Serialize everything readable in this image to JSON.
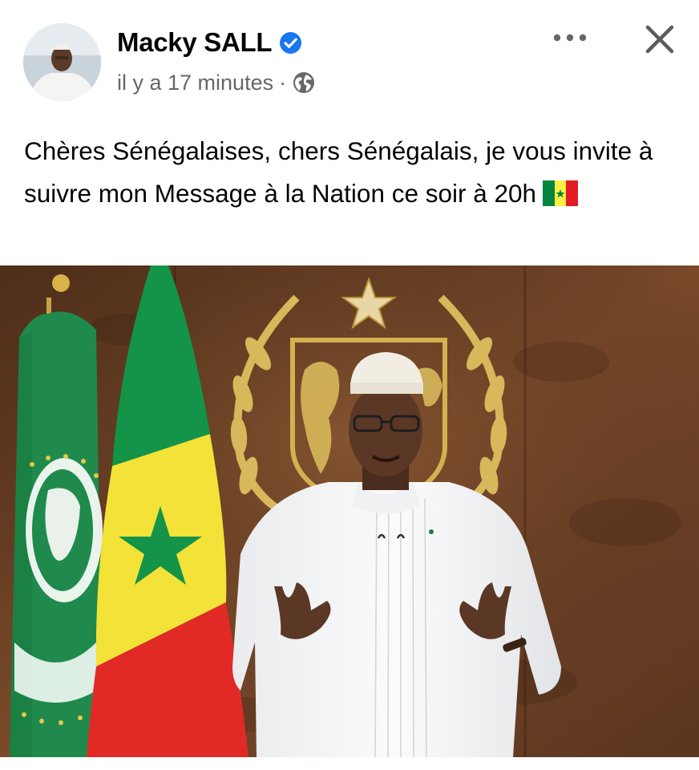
{
  "post": {
    "author": "Macky SALL",
    "verified_badge": "verified-badge-icon",
    "timestamp": "il y a 17 minutes",
    "separator": "·",
    "audience_icon": "globe-icon",
    "text": "Chères Sénégalaises, chers Sénégalais, je vous invite à suivre mon Message à la Nation ce soir à 20h",
    "emoji": "senegal-flag-emoji"
  },
  "actions": {
    "more_icon": "more-options-icon",
    "close_icon": "close-icon"
  },
  "colors": {
    "verified_blue": "#1877f2",
    "meta_gray": "#65676b",
    "flag_green": "#00853f",
    "flag_yellow": "#fdef42",
    "flag_red": "#e31b23",
    "au_green": "#1f8a4c",
    "wall_brown": "#6b4024",
    "emblem_gold": "#d7b85a"
  }
}
